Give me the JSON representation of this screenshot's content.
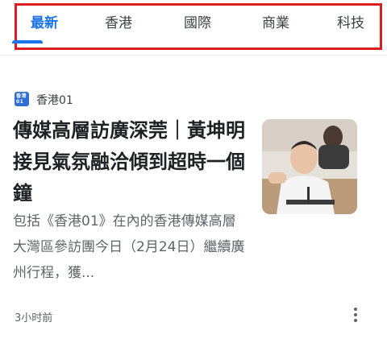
{
  "tabs": [
    {
      "label": "最新",
      "active": true
    },
    {
      "label": "香港",
      "active": false
    },
    {
      "label": "國際",
      "active": false
    },
    {
      "label": "商業",
      "active": false
    },
    {
      "label": "科技",
      "active": false
    }
  ],
  "colors": {
    "accent": "#1a73e8",
    "highlight_border": "#d81e1e",
    "source_logo": "#2f6fd0"
  },
  "article": {
    "source": {
      "logo_line1": "香港",
      "logo_line2": "01",
      "name": "香港01"
    },
    "headline": "傳媒高層訪廣深莞｜黃坤明接見氣氛融洽傾到超時一個鐘",
    "snippet": "包括《香港01》在內的香港傳媒高層大灣區參訪團今日（2月24日）繼續廣州行程，獲...",
    "timestamp": "3小时前",
    "thumbnail_icon": "news-photo",
    "more_icon": "more-vert-icon"
  }
}
